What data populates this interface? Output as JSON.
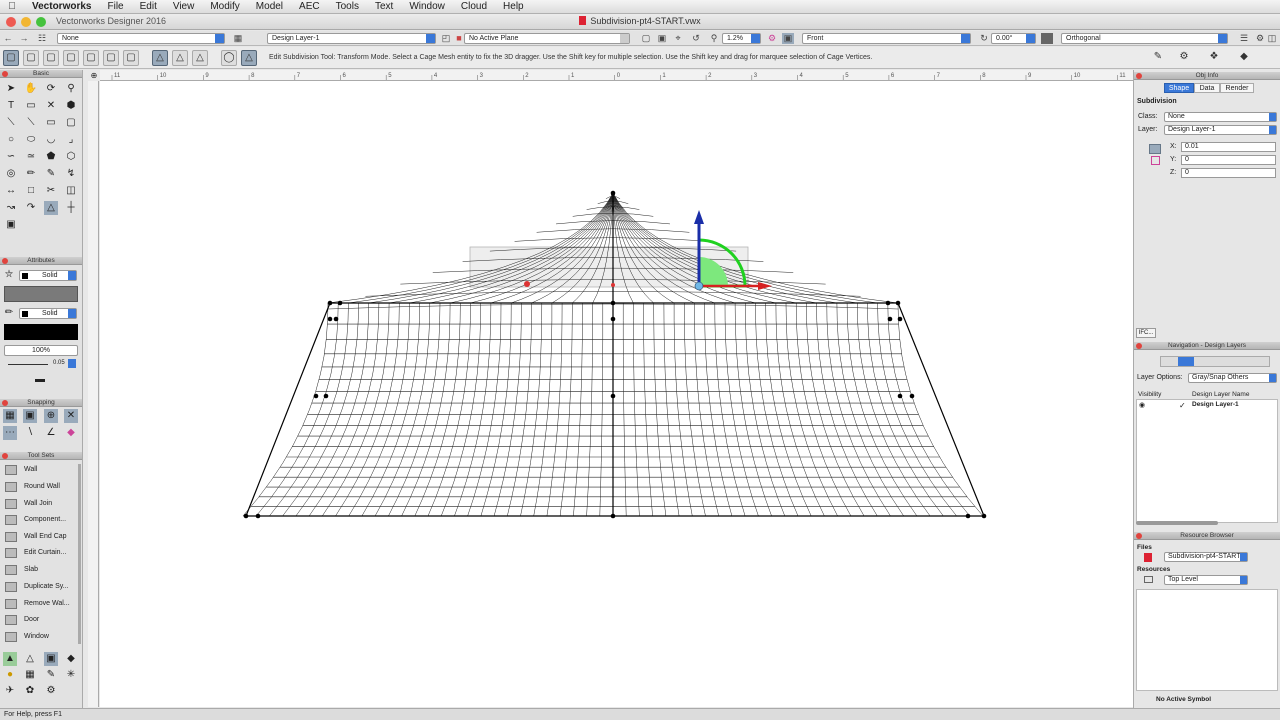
{
  "menubar": {
    "items": [
      "Vectorworks",
      "File",
      "Edit",
      "View",
      "Modify",
      "Model",
      "AEC",
      "Tools",
      "Text",
      "Window",
      "Cloud",
      "Help"
    ]
  },
  "window": {
    "app_name": "Vectorworks Designer 2016",
    "document_title": "Subdivision-pt4-START.vwx"
  },
  "view_bar": {
    "class": "None",
    "layer": "Design Layer-1",
    "plane": "No Active Plane",
    "zoom": "1.2%",
    "view": "Front",
    "rotation": "0.00°",
    "projection": "Orthogonal"
  },
  "mode_bar": {
    "help_text": "Edit Subdivision Tool: Transform Mode. Select a Cage Mesh entity to fix the 3D dragger.  Use the Shift key for multiple selection.  Use the Shift key and drag for marquee selection of Cage Vertices."
  },
  "palettes": {
    "basic": "Basic",
    "attributes": "Attributes",
    "snapping": "Snapping",
    "tool_sets": "Tool Sets"
  },
  "attributes": {
    "fill_style": "Solid",
    "pen_style": "Solid",
    "opacity": "100%",
    "line_weight": "0.05"
  },
  "tool_sets": [
    "Wall",
    "Round Wall",
    "Wall Join",
    "Component...",
    "Wall End Cap",
    "Edit Curtain...",
    "Slab",
    "Duplicate Sy...",
    "Remove Wal...",
    "Door",
    "Window"
  ],
  "ruler": {
    "ticks": [
      "11",
      "10",
      "9",
      "8",
      "7",
      "6",
      "5",
      "4",
      "3",
      "2",
      "1",
      "0",
      "1",
      "2",
      "3",
      "4",
      "5",
      "6",
      "7",
      "8",
      "9",
      "10",
      "11"
    ]
  },
  "obj_info": {
    "title": "Obj Info",
    "tabs": [
      "Shape",
      "Data",
      "Render"
    ],
    "object_type": "Subdivision",
    "class_label": "Class:",
    "class_value": "None",
    "layer_label": "Layer:",
    "layer_value": "Design Layer-1",
    "x_label": "X:",
    "x_value": "0.01",
    "y_label": "Y:",
    "y_value": "0",
    "z_label": "Z:",
    "z_value": "0",
    "ifc": "IFC..."
  },
  "navigation": {
    "title": "Navigation - Design Layers",
    "layer_options_label": "Layer Options:",
    "layer_options_value": "Gray/Snap Others",
    "col_visibility": "Visibility",
    "col_name": "Design Layer Name",
    "row_check": "✓",
    "row_name": "Design Layer-1"
  },
  "resource_browser": {
    "title": "Resource Browser",
    "files_label": "Files",
    "file_value": "Subdivision-pt4-START",
    "resources_label": "Resources",
    "folder_value": "Top Level",
    "active_symbol": "No Active Symbol"
  },
  "status_bar": {
    "text": "For Help, press F1"
  },
  "colors": {
    "accent": "#3a78d8",
    "gizmo_z": "#1a2ea8",
    "gizmo_x": "#d62020",
    "gizmo_rot": "#1fd11f"
  }
}
